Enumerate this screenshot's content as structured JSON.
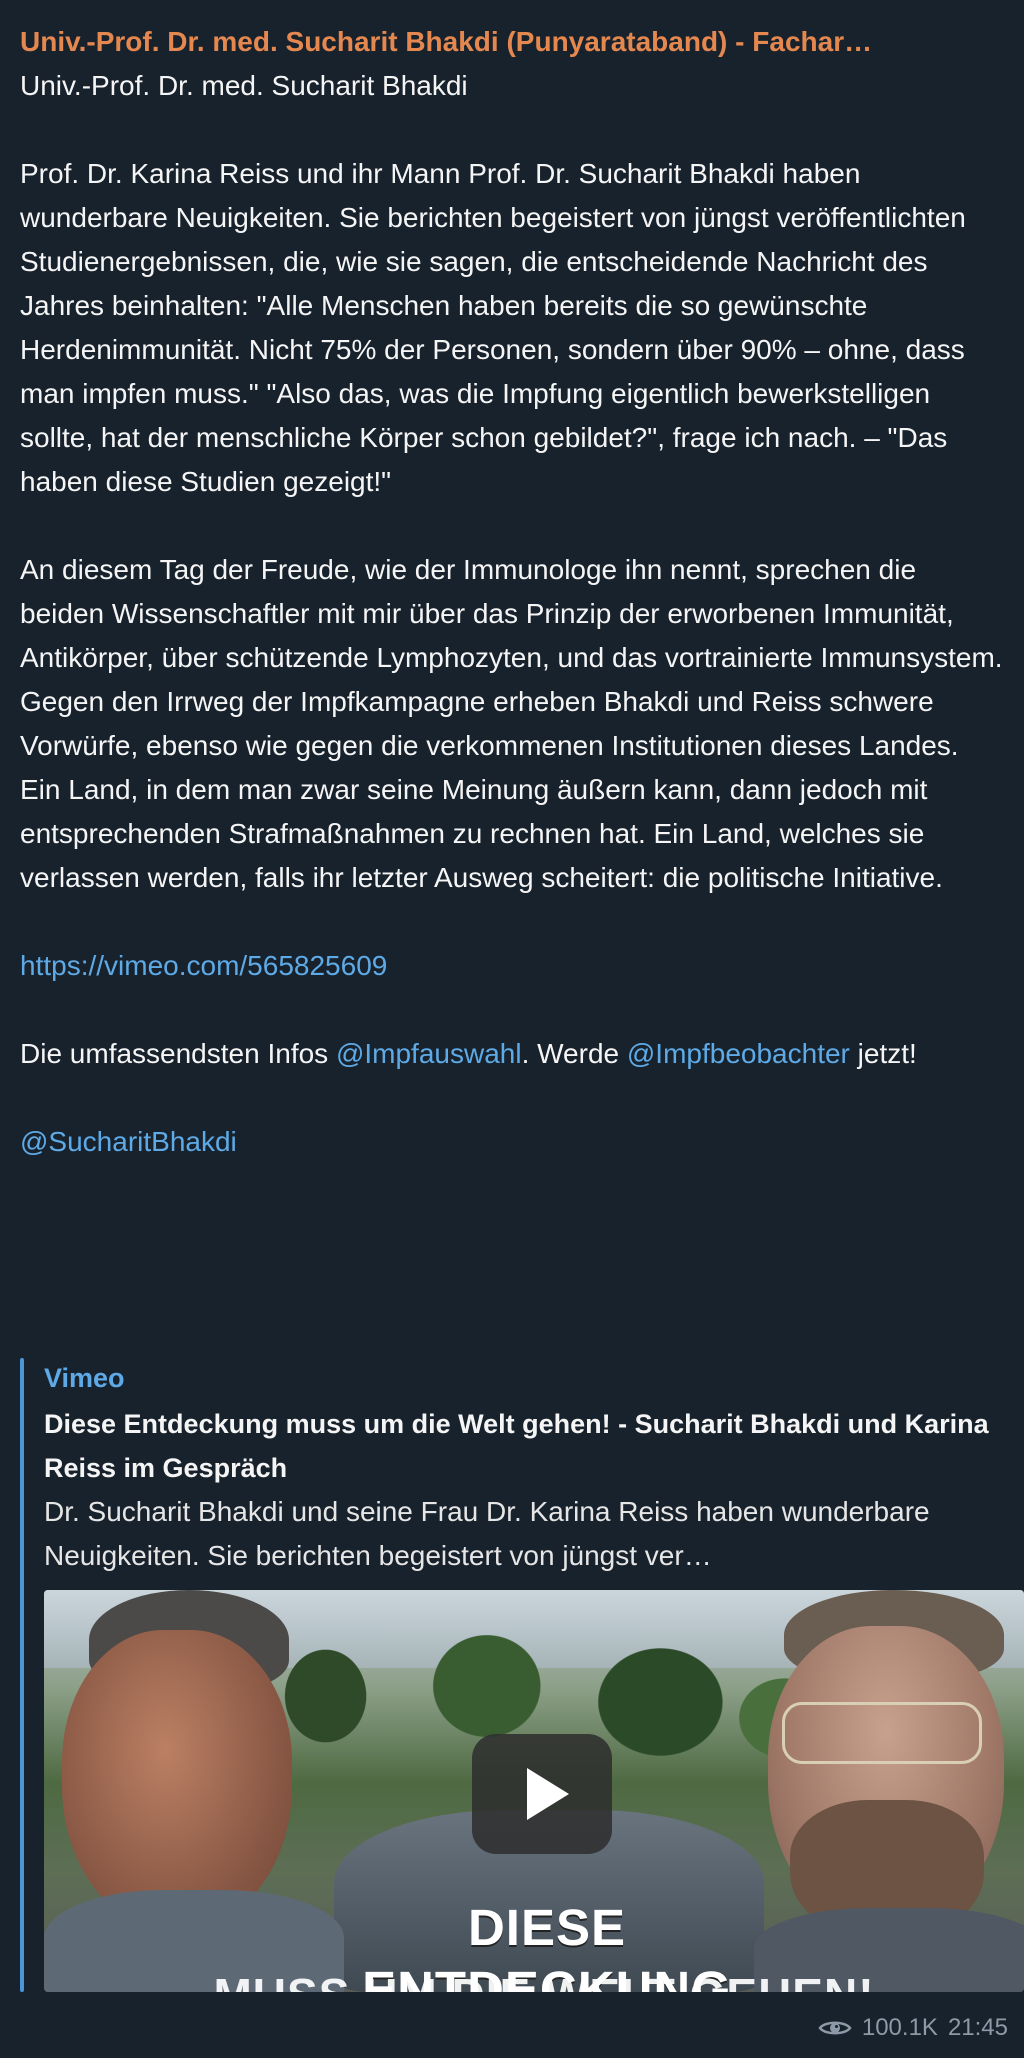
{
  "message": {
    "sender": "Univ.-Prof. Dr. med. Sucharit Bhakdi (Punyarataband) - Fachar…",
    "author": "Univ.-Prof. Dr. med. Sucharit Bhakdi",
    "paragraph1": "Prof. Dr. Karina Reiss und ihr Mann Prof. Dr. Sucharit Bhakdi haben wunderbare Neuigkeiten. Sie berichten begeistert von jüngst veröffentlichten Studienergebnissen, die, wie sie sagen, die entscheidende Nachricht des Jahres beinhalten: \"Alle Menschen haben bereits die so gewünschte Herdenimmunität. Nicht 75% der Personen, sondern über 90% – ohne, dass man impfen muss.\" \"Also das, was die Impfung eigentlich bewerkstelligen sollte, hat der menschliche Körper schon gebildet?\", frage ich nach. – \"Das haben diese Studien gezeigt!\"",
    "paragraph2": "An diesem Tag der Freude, wie der Immunologe ihn nennt, sprechen die beiden Wissenschaftler mit mir über das Prinzip der erworbenen Immunität, Antikörper, über schützende Lymphozyten, und das vortrainierte Immunsystem. Gegen den Irrweg der Impfkampagne erheben Bhakdi und Reiss schwere Vorwürfe, ebenso wie gegen die verkommenen Institutionen dieses Landes. Ein Land, in dem man zwar seine Meinung äußern kann, dann jedoch mit entsprechenden Strafmaßnahmen zu rechnen hat. Ein Land, welches sie verlassen werden, falls ihr letzter Ausweg scheitert: die politische Initiative.",
    "vimeo_link": "https://vimeo.com/565825609",
    "info_prefix": "Die umfassendsten Infos ",
    "info_mention1": "@Impfauswahl",
    "info_middle": ". Werde ",
    "info_mention2": "@Impfbeobachter",
    "info_suffix": " jetzt!",
    "author_mention": "@SucharitBhakdi"
  },
  "preview": {
    "site": "Vimeo",
    "title": "Diese Entdeckung muss um die Welt gehen! - Sucharit Bhakdi und Karina Reiss im Gespräch",
    "description": "Dr. Sucharit Bhakdi und seine Frau Dr. Karina Reiss haben wunderbare Neuigkeiten. Sie berichten begeistert von jüngst ver…",
    "video_caption_line1": "DIESE ENTDECKUNG",
    "video_caption_line2": "MUSS UM DIE WELT GEHEN!"
  },
  "footer": {
    "views": "100.1K",
    "time": "21:45",
    "icon": "eye-icon"
  },
  "colors": {
    "background": "#18222d",
    "sender": "#e5884f",
    "link": "#5eaae6",
    "meta": "#8d99a6",
    "preview_accent": "#4b95d9"
  }
}
